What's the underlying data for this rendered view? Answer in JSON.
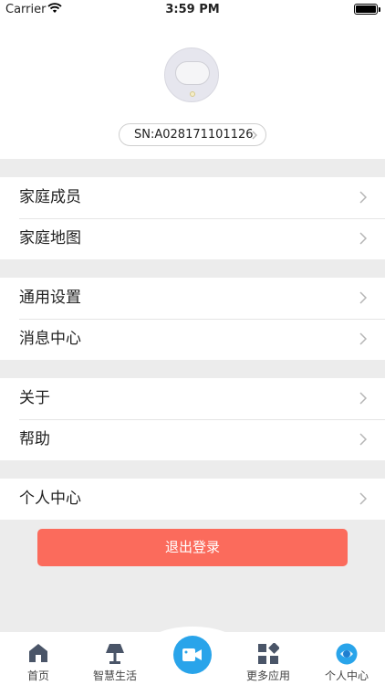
{
  "status_bar": {
    "carrier": "Carrier",
    "time": "3:59 PM"
  },
  "device": {
    "sn": "SN:A028171101126"
  },
  "menu_groups": [
    [
      {
        "label": "家庭成员"
      },
      {
        "label": "家庭地图"
      }
    ],
    [
      {
        "label": "通用设置"
      },
      {
        "label": "消息中心"
      }
    ],
    [
      {
        "label": "关于"
      },
      {
        "label": "帮助"
      }
    ],
    [
      {
        "label": "个人中心"
      }
    ]
  ],
  "logout_label": "退出登录",
  "tabs": [
    {
      "label": "首页",
      "icon": "home-icon"
    },
    {
      "label": "智慧生活",
      "icon": "lamp-icon"
    },
    {
      "label": "",
      "icon": "video-camera-icon"
    },
    {
      "label": "更多应用",
      "icon": "apps-grid-icon"
    },
    {
      "label": "个人中心",
      "icon": "profile-icon"
    }
  ],
  "colors": {
    "accent": "#29a4ea",
    "logout": "#fb6b5c",
    "background": "#ececec"
  }
}
